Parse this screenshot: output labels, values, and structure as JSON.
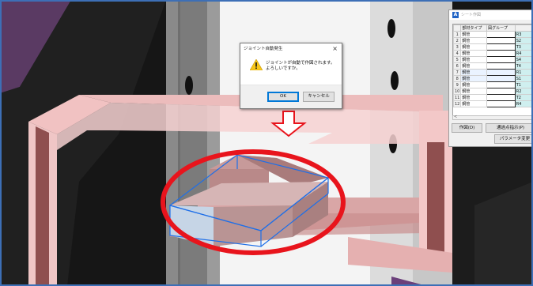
{
  "joint_dialog": {
    "title": "ジョイント自動発生",
    "close_glyph": "×",
    "message_line1": "ジョイントが自動で作図されます。",
    "message_line2": "よろしいですか。",
    "ok_label": "OK",
    "cancel_label": "キャンセル"
  },
  "sheet_window": {
    "app_icon": "A",
    "title": "シート作図",
    "columns": [
      "",
      "部材タイプ",
      "図グループ",
      ""
    ],
    "rows": [
      {
        "no": "1",
        "type": "鋼管",
        "group": "",
        "code": "R3"
      },
      {
        "no": "2",
        "type": "鋼管",
        "group": "",
        "code": "S2"
      },
      {
        "no": "3",
        "type": "鋼管",
        "group": "",
        "code": "T3"
      },
      {
        "no": "4",
        "type": "鋼管",
        "group": "",
        "code": "R4"
      },
      {
        "no": "5",
        "type": "鋼管",
        "group": "",
        "code": "S4"
      },
      {
        "no": "6",
        "type": "鋼管",
        "group": "",
        "code": "T4"
      },
      {
        "no": "7",
        "type": "鋼管",
        "group": "",
        "code": "R1"
      },
      {
        "no": "8",
        "type": "鋼管",
        "group": "",
        "code": "S1"
      },
      {
        "no": "9",
        "type": "鋼管",
        "group": "",
        "code": "T1"
      },
      {
        "no": "10",
        "type": "鋼管",
        "group": "",
        "code": "R2"
      },
      {
        "no": "11",
        "type": "鋼管",
        "group": "",
        "code": "T2"
      },
      {
        "no": "12",
        "type": "鋼管",
        "group": "",
        "code": "R4"
      }
    ],
    "scroll_left_glyph": "<",
    "draw_button": "作図(D)",
    "show_points_button": "通過点指示(P)",
    "param_button": "パラメータ変更"
  },
  "colors": {
    "highlight_ellipse": "#e8141c",
    "arrow_outline": "#e8141c",
    "selection_outline": "#1e6fe8",
    "beam_fill": "#e9b5b5"
  },
  "icons": {
    "warning": "warning-icon",
    "down_arrow": "down-arrow-icon"
  }
}
